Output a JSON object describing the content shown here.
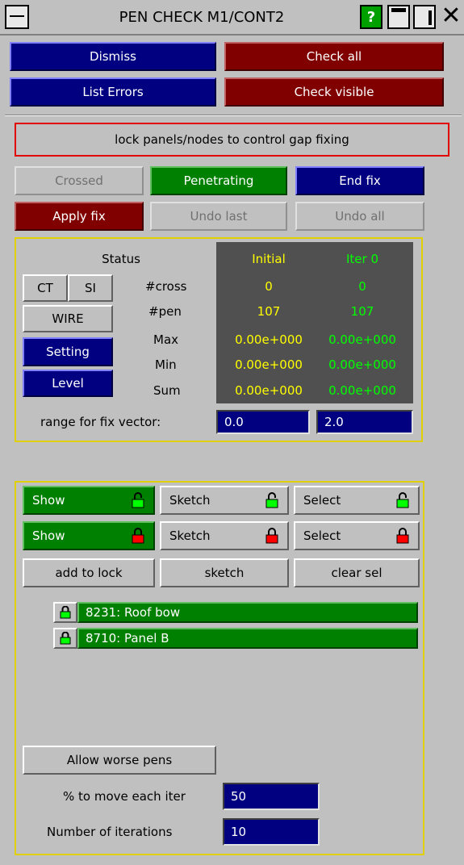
{
  "window": {
    "title": "PEN CHECK M1/CONT2"
  },
  "toolbar": {
    "dismiss": "Dismiss",
    "check_all": "Check all",
    "list_errors": "List Errors",
    "check_visible": "Check visible"
  },
  "lock_message": "lock panels/nodes to control gap fixing",
  "modes": {
    "crossed": "Crossed",
    "penetrating": "Penetrating",
    "end_fix": "End fix",
    "apply_fix": "Apply fix",
    "undo_last": "Undo last",
    "undo_all": "Undo all"
  },
  "status": {
    "heading": "Status",
    "col_initial": "Initial",
    "col_iter": "Iter 0",
    "rows": [
      {
        "label": "#cross",
        "initial": "0",
        "iter": "0"
      },
      {
        "label": "#pen",
        "initial": "107",
        "iter": "107"
      },
      {
        "label": "Max",
        "initial": "0.00e+000",
        "iter": "0.00e+000"
      },
      {
        "label": "Min",
        "initial": "0.00e+000",
        "iter": "0.00e+000"
      },
      {
        "label": "Sum",
        "initial": "0.00e+000",
        "iter": "0.00e+000"
      }
    ],
    "side_buttons": {
      "ct": "CT",
      "si": "SI",
      "wire": "WIRE",
      "setting": "Setting",
      "level": "Level"
    },
    "range_label": "range for fix vector:",
    "range_min": "0.0",
    "range_max": "2.0"
  },
  "lock_controls": {
    "row1": {
      "show": "Show",
      "sketch": "Sketch",
      "select": "Select"
    },
    "row2": {
      "show": "Show",
      "sketch": "Sketch",
      "select": "Select"
    },
    "add_to_lock": "add to lock",
    "sketch": "sketch",
    "clear_sel": "clear sel"
  },
  "locked_items": [
    {
      "label": "8231: Roof bow"
    },
    {
      "label": "8710: Panel B"
    }
  ],
  "options": {
    "allow_worse": "Allow worse pens",
    "pct_label": "% to move each iter",
    "pct_value": "50",
    "iter_label": "Number of iterations",
    "iter_value": "10"
  },
  "colors": {
    "accent_navy": "#000080",
    "accent_maroon": "#800000",
    "accent_green": "#008000",
    "unlocked": "#00ff00",
    "locked": "#ff0000"
  }
}
